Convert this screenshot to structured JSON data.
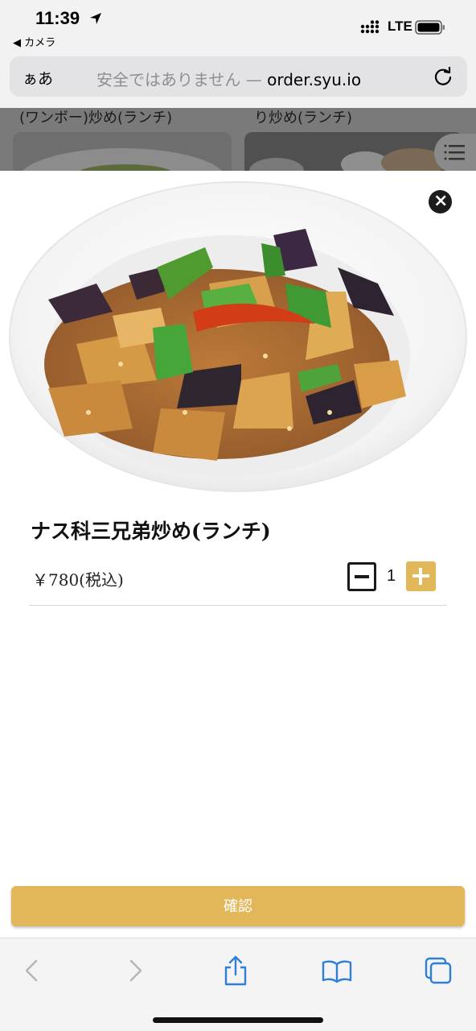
{
  "status_bar": {
    "time": "11:39",
    "back_app": "◀ カメラ",
    "network": "LTE"
  },
  "address_bar": {
    "text_size_label": "ぁあ",
    "security_warning": "安全ではありません —",
    "host": "order.syu.io"
  },
  "background_page": {
    "card1_title": "(ワンボー)炒め(ランチ)",
    "card2_title": "り炒め(ランチ)"
  },
  "modal": {
    "item_name": "ナス科三兄弟炒め(ランチ)",
    "price": "￥780(税込)",
    "quantity": "1",
    "confirm_label": "確認"
  },
  "colors": {
    "accent": "#e2b75a",
    "link": "#2f7fd8"
  },
  "icons": {
    "close": "close-icon",
    "minus": "minus-icon",
    "plus": "plus-icon",
    "back": "chevron-left-icon",
    "forward": "chevron-right-icon",
    "share": "share-icon",
    "bookmarks": "book-icon",
    "tabs": "tabs-icon",
    "reload": "reload-icon",
    "menu": "hamburger-icon"
  }
}
